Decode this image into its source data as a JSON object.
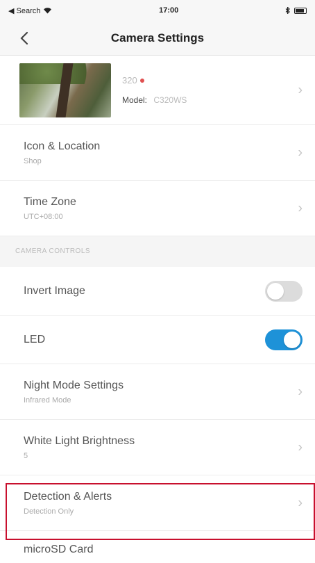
{
  "status_bar": {
    "back_to_app": "◀ Search",
    "time": "17:00"
  },
  "header": {
    "title": "Camera Settings"
  },
  "device": {
    "name": "320",
    "model_label": "Model:",
    "model_value": "C320WS"
  },
  "settings": {
    "icon_location": {
      "title": "Icon & Location",
      "sub": "Shop"
    },
    "time_zone": {
      "title": "Time Zone",
      "sub": "UTC+08:00"
    }
  },
  "camera_controls": {
    "header": "CAMERA CONTROLS",
    "invert_image": {
      "title": "Invert Image",
      "enabled": false
    },
    "led": {
      "title": "LED",
      "enabled": true
    },
    "night_mode": {
      "title": "Night Mode Settings",
      "sub": "Infrared Mode"
    },
    "white_light": {
      "title": "White Light Brightness",
      "sub": "5"
    },
    "detection": {
      "title": "Detection & Alerts",
      "sub": "Detection Only"
    },
    "microsd": {
      "title": "microSD Card"
    }
  },
  "colors": {
    "accent": "#1e92d8",
    "highlight": "#c8102e"
  }
}
